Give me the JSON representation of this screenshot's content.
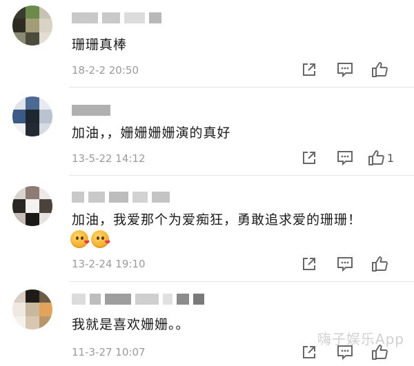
{
  "comments": [
    {
      "text": "珊珊真棒",
      "time": "18-2-2 20:50",
      "likes": "",
      "emojis": false
    },
    {
      "text": "加油，，姗姗姗姗演的真好",
      "time": "13-5-22 14:12",
      "likes": "1",
      "emojis": false
    },
    {
      "text": "加油，我爱那个为爱痴狂，勇敢追求爱的珊珊！",
      "time": "13-2-24 19:10",
      "likes": "",
      "emojis": true
    },
    {
      "text": "我就是喜欢姗姗。。",
      "time": "11-3-27 10:07",
      "likes": "",
      "emojis": false
    }
  ],
  "icons": {
    "share": "share-icon",
    "reply": "comment-icon",
    "like": "thumbs-up-icon"
  },
  "watermark": "嗨子娱乐App",
  "colors": {
    "text": "#1a1a1a",
    "meta": "#9a9a9a",
    "icon": "#666666",
    "divider": "#e6e6e6"
  }
}
